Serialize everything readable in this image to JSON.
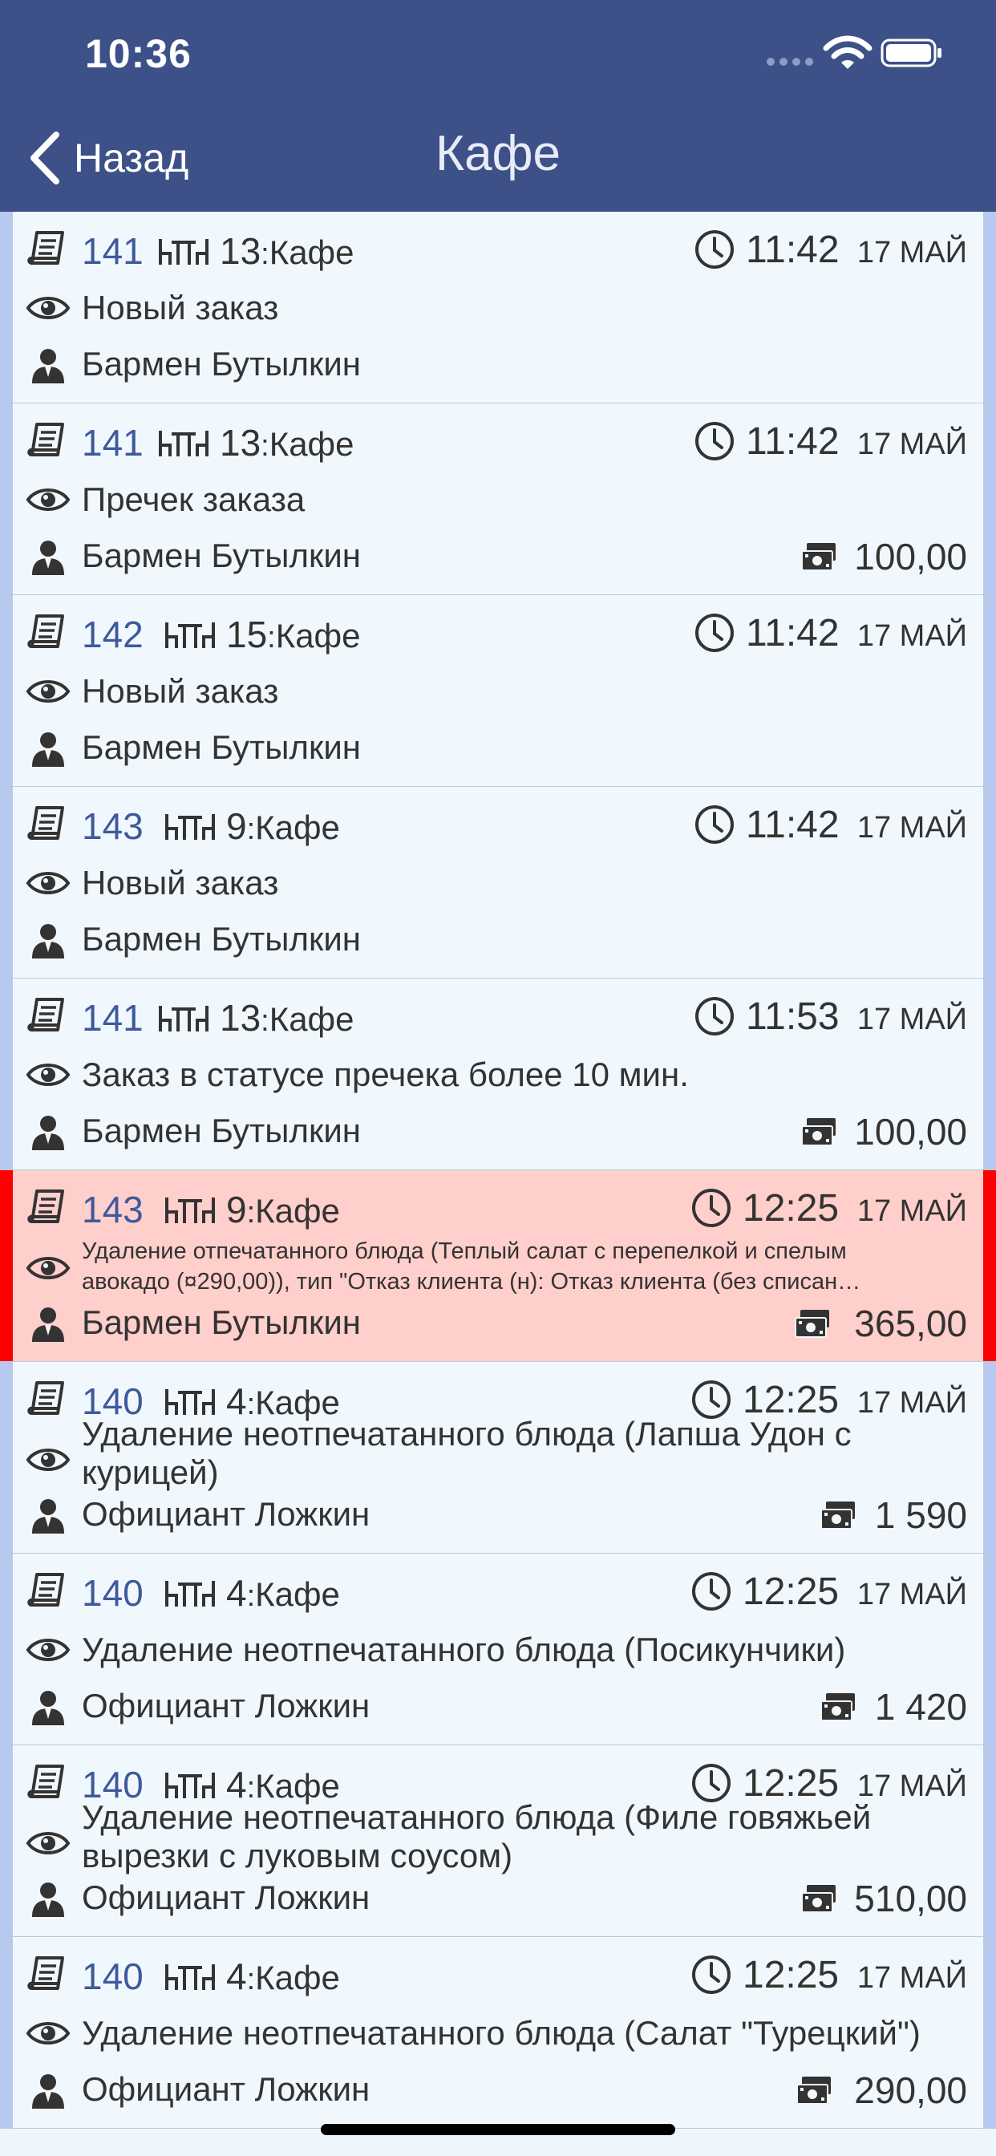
{
  "status_bar": {
    "time": "10:36"
  },
  "nav": {
    "back_label": "Назад",
    "title": "Кафе"
  },
  "rows": [
    {
      "order": "141",
      "table": "13",
      "sep": ":",
      "hall": "Кафе",
      "time": "11:42",
      "date": "17 МАЙ",
      "event": "Новый заказ",
      "user": "Бармен Бутылкин",
      "amount": ""
    },
    {
      "order": "141",
      "table": "13",
      "sep": ":",
      "hall": "Кафе",
      "time": "11:42",
      "date": "17 МАЙ",
      "event": "Пречек заказа",
      "user": "Бармен Бутылкин",
      "amount": "100,00"
    },
    {
      "order": "142",
      "table": "15",
      "sep": ":",
      "hall": "Кафе",
      "time": "11:42",
      "date": "17 МАЙ",
      "event": "Новый заказ",
      "user": "Бармен Бутылкин",
      "amount": ""
    },
    {
      "order": "143",
      "table": "9",
      "sep": ":",
      "hall": "Кафе",
      "time": "11:42",
      "date": "17 МАЙ",
      "event": "Новый заказ",
      "user": "Бармен Бутылкин",
      "amount": ""
    },
    {
      "order": "141",
      "table": "13",
      "sep": ":",
      "hall": "Кафе",
      "time": "11:53",
      "date": "17 МАЙ",
      "event": "Заказ в статусе пречека более 10 мин.",
      "user": "Бармен Бутылкин",
      "amount": "100,00"
    },
    {
      "order": "143",
      "table": "9",
      "sep": ":",
      "hall": "Кафе",
      "time": "12:25",
      "date": "17 МАЙ",
      "event_line1": "Удаление отпечатанного блюда (Теплый салат с перепелкой и спелым",
      "event_line2": "авокадо (¤290,00)), тип \"Отказ клиента (н): Отказ клиента (без списан…",
      "user": "Бармен Бутылкин",
      "amount": "365,00"
    },
    {
      "order": "140",
      "table": "4",
      "sep": ":",
      "hall": "Кафе",
      "time": "12:25",
      "date": "17 МАЙ",
      "event": "Удаление неотпечатанного блюда (Лапша Удон с курицей)",
      "user": "Официант Ложкин",
      "amount": "1 590"
    },
    {
      "order": "140",
      "table": "4",
      "sep": ":",
      "hall": "Кафе",
      "time": "12:25",
      "date": "17 МАЙ",
      "event": "Удаление неотпечатанного блюда (Посикунчики)",
      "user": "Официант Ложкин",
      "amount": "1 420"
    },
    {
      "order": "140",
      "table": "4",
      "sep": ":",
      "hall": "Кафе",
      "time": "12:25",
      "date": "17 МАЙ",
      "event": "Удаление неотпечатанного блюда (Филе говяжьей вырезки с луковым соусом)",
      "user": "Официант Ложкин",
      "amount": "510,00"
    },
    {
      "order": "140",
      "table": "4",
      "sep": ":",
      "hall": "Кафе",
      "time": "12:25",
      "date": "17 МАЙ",
      "event": "Удаление неотпечатанного блюда (Салат \"Турецкий\")",
      "user": "Официант Ложкин",
      "amount": "290,00"
    }
  ],
  "colors": {
    "nav_bg": "#3d5088",
    "order_number": "#3d5a9c",
    "alert_row_bg": "#ffcfcb",
    "alert_edge": "#ff0000"
  }
}
